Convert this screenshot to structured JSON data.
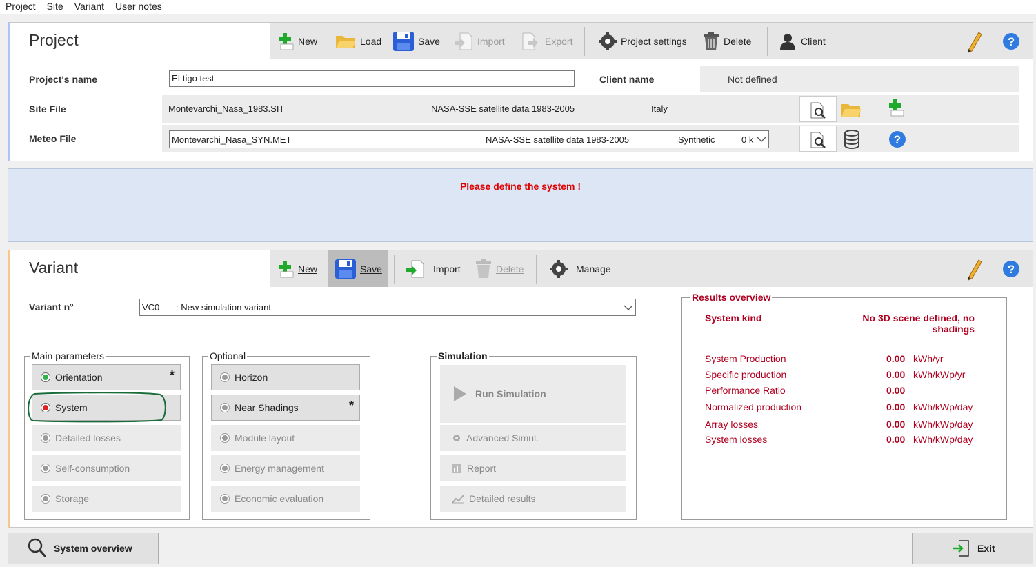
{
  "menu": [
    "Project",
    "Site",
    "Variant",
    "User notes"
  ],
  "project": {
    "title": "Project",
    "toolbar": {
      "new": "New",
      "load": "Load",
      "save": "Save",
      "import": "Import",
      "export": "Export",
      "settings": "Project settings",
      "delete": "Delete",
      "client": "Client"
    },
    "name_label": "Project's name",
    "name_value": "EI tigo test",
    "client_label": "Client name",
    "client_value": "Not defined",
    "site_label": "Site File",
    "site_file": "Montevarchi_Nasa_1983.SIT",
    "site_source": "NASA-SSE satellite data 1983-2005",
    "site_country": "Italy",
    "meteo_label": "Meteo File",
    "meteo_file": "Montevarchi_Nasa_SYN.MET",
    "meteo_source": "NASA-SSE satellite data 1983-2005",
    "meteo_type": "Synthetic",
    "meteo_extra": "0 k"
  },
  "message": "Please define the system !",
  "variant": {
    "title": "Variant",
    "toolbar": {
      "new": "New",
      "save": "Save",
      "import": "Import",
      "delete": "Delete",
      "manage": "Manage"
    },
    "num_label": "Variant n°",
    "num_code": "VC0",
    "num_desc": ": New simulation variant",
    "main_params": {
      "label": "Main parameters",
      "items": [
        "Orientation",
        "System",
        "Detailed losses",
        "Self-consumption",
        "Storage"
      ]
    },
    "optional": {
      "label": "Optional",
      "items": [
        "Horizon",
        "Near Shadings",
        "Module layout",
        "Energy management",
        "Economic evaluation"
      ]
    },
    "simulation": {
      "label": "Simulation",
      "run": "Run Simulation",
      "advanced": "Advanced Simul.",
      "report": "Report",
      "detailed": "Detailed results"
    },
    "results": {
      "label": "Results overview",
      "kind_label": "System kind",
      "kind_value": "No 3D scene defined, no shadings",
      "rows": [
        {
          "name": "System Production",
          "value": "0.00",
          "unit": "kWh/yr"
        },
        {
          "name": "Specific production",
          "value": "0.00",
          "unit": "kWh/kWp/yr"
        },
        {
          "name": "Performance Ratio",
          "value": "0.00",
          "unit": ""
        },
        {
          "name": "Normalized production",
          "value": "0.00",
          "unit": "kWh/kWp/day"
        },
        {
          "name": "Array losses",
          "value": "0.00",
          "unit": "kWh/kWp/day"
        },
        {
          "name": "System losses",
          "value": "0.00",
          "unit": "kWh/kWp/day"
        }
      ]
    }
  },
  "bottom": {
    "overview": "System overview",
    "exit": "Exit"
  },
  "colors": {
    "accent_project": "#a9c4f5",
    "accent_variant": "#f7c88c",
    "message": "#e00000",
    "results": "#b00020",
    "annotation": "#1a6b3a"
  }
}
